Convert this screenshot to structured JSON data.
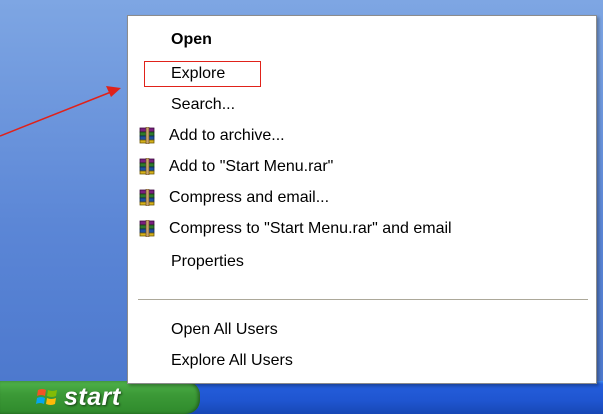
{
  "start": {
    "label": "start"
  },
  "menu": {
    "items": [
      {
        "label": "Open",
        "bold": true
      },
      {
        "label": "Explore"
      },
      {
        "label": "Search..."
      },
      {
        "label": "Add to archive...",
        "icon": "winrar-icon"
      },
      {
        "label": "Add to \"Start Menu.rar\"",
        "icon": "winrar-icon"
      },
      {
        "label": "Compress and email...",
        "icon": "winrar-icon"
      },
      {
        "label": "Compress to \"Start Menu.rar\" and email",
        "icon": "winrar-icon"
      },
      {
        "label": "Properties"
      }
    ],
    "bottom_items": [
      {
        "label": "Open All Users"
      },
      {
        "label": "Explore All Users"
      }
    ]
  },
  "annotation": {
    "color": "#e0221a"
  },
  "colors": {
    "taskbar": "#245edc",
    "start_button": "#3c9a37",
    "desktop": "#5b86d6"
  }
}
